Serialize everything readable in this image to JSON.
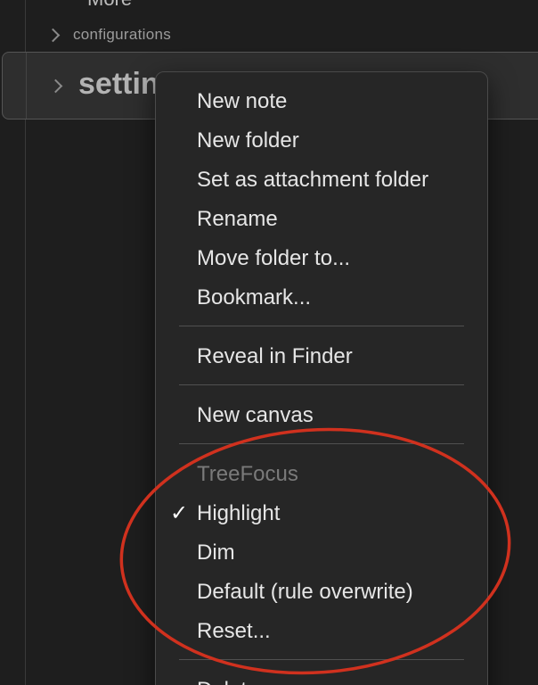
{
  "tree": {
    "more_label": "More",
    "configurations_label": "configurations",
    "selected_label": "settings"
  },
  "menu": {
    "items": [
      {
        "label": "New note"
      },
      {
        "label": "New folder"
      },
      {
        "label": "Set as attachment folder"
      },
      {
        "label": "Rename"
      },
      {
        "label": "Move folder to..."
      },
      {
        "label": "Bookmark..."
      },
      {
        "label": "Reveal in Finder"
      },
      {
        "label": "New canvas"
      },
      {
        "label": "Highlight",
        "checked": true
      },
      {
        "label": "Dim"
      },
      {
        "label": "Default (rule overwrite)"
      },
      {
        "label": "Reset..."
      },
      {
        "label": "Delete"
      }
    ],
    "section_heading": "TreeFocus",
    "check_glyph": "✓"
  },
  "annotation": {
    "color": "#d0311e",
    "shape": "ellipse"
  },
  "colors": {
    "background": "#1e1e1e",
    "menu_background": "#262626",
    "menu_text": "#e6e6e6",
    "heading_text": "#7a7a7a"
  }
}
